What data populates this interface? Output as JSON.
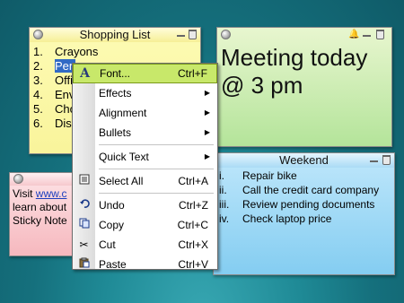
{
  "shopping_note": {
    "title": "Shopping List",
    "items": [
      {
        "num": "1.",
        "text": "Crayons"
      },
      {
        "num": "2.",
        "text": "Pen"
      },
      {
        "num": "3.",
        "text": "Offi"
      },
      {
        "num": "4.",
        "text": "Env"
      },
      {
        "num": "5.",
        "text": "Cho"
      },
      {
        "num": "6.",
        "text": "Dis"
      }
    ],
    "color": "#f9f49b"
  },
  "meeting_note": {
    "text_line1": "Meeting today",
    "text_line2": "@ 3 pm",
    "color": "#b4e49a"
  },
  "weekend_note": {
    "title": "Weekend",
    "items": [
      {
        "num": "i.",
        "text": "Repair bike"
      },
      {
        "num": "ii.",
        "text": "Call the credit card company"
      },
      {
        "num": "iii.",
        "text": "Review pending documents"
      },
      {
        "num": "iv.",
        "text": "Check laptop price"
      }
    ],
    "color": "#84cdf1"
  },
  "visit_note": {
    "line1_prefix": "Visit ",
    "line1_link": "www.c",
    "line2": "learn about",
    "line3": "Sticky Note",
    "color": "#f6b8be"
  },
  "context_menu": {
    "items": {
      "font": {
        "label": "Font...",
        "shortcut": "Ctrl+F",
        "icon": "font-a-icon"
      },
      "effects": {
        "label": "Effects"
      },
      "alignment": {
        "label": "Alignment"
      },
      "bullets": {
        "label": "Bullets"
      },
      "quick_text": {
        "label": "Quick Text"
      },
      "select_all": {
        "label": "Select All",
        "shortcut": "Ctrl+A",
        "icon": "select-all-icon"
      },
      "undo": {
        "label": "Undo",
        "shortcut": "Ctrl+Z",
        "icon": "undo-arrow-icon"
      },
      "copy": {
        "label": "Copy",
        "shortcut": "Ctrl+C",
        "icon": "copy-icon"
      },
      "cut": {
        "label": "Cut",
        "shortcut": "Ctrl+X",
        "icon": "scissors-icon"
      },
      "paste": {
        "label": "Paste",
        "shortcut": "Ctrl+V",
        "icon": "paste-icon"
      }
    },
    "highlight_color": "#c8e86a"
  }
}
